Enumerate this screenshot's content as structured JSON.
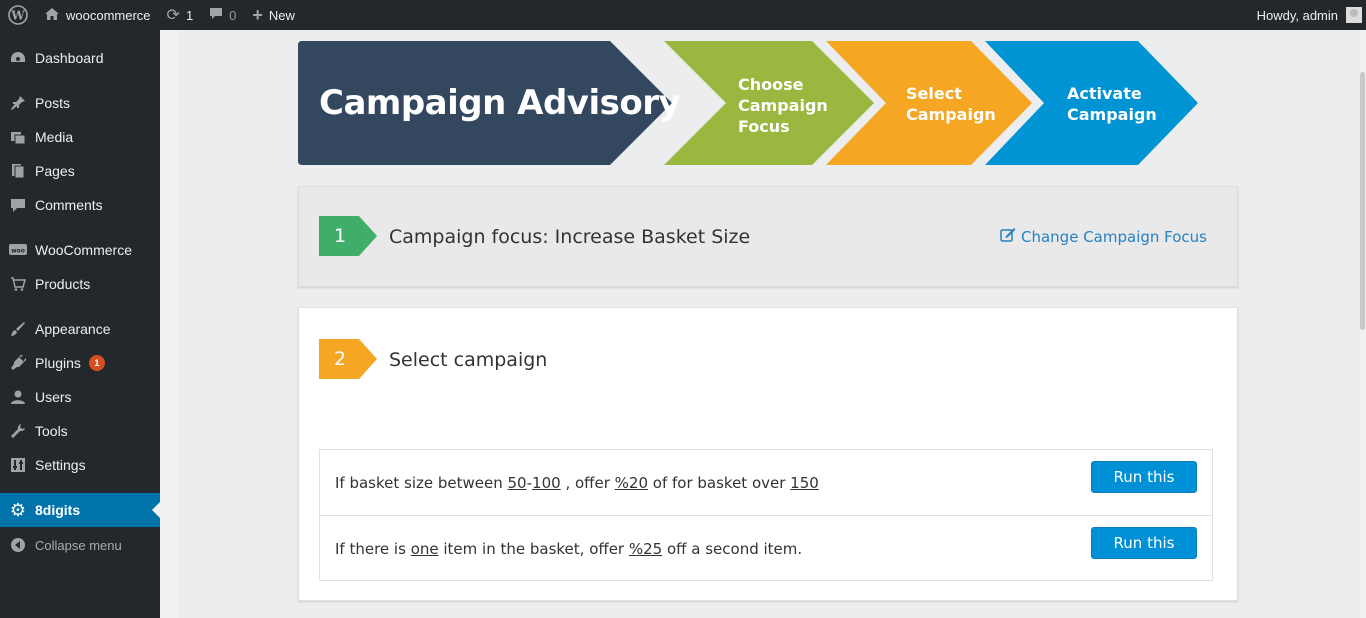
{
  "adminbar": {
    "site_name": "woocommerce",
    "updates_count": "1",
    "comments_count": "0",
    "new_label": "New",
    "howdy": "Howdy, admin"
  },
  "sidebar": {
    "items": [
      {
        "label": "Dashboard",
        "icon": "dashboard-icon"
      },
      {
        "label": "Posts",
        "icon": "pin-icon"
      },
      {
        "label": "Media",
        "icon": "media-icon"
      },
      {
        "label": "Pages",
        "icon": "pages-icon"
      },
      {
        "label": "Comments",
        "icon": "comment-icon"
      },
      {
        "label": "WooCommerce",
        "icon": "woo-icon"
      },
      {
        "label": "Products",
        "icon": "cart-icon"
      },
      {
        "label": "Appearance",
        "icon": "brush-icon"
      },
      {
        "label": "Plugins",
        "icon": "plugin-icon",
        "badge": "1"
      },
      {
        "label": "Users",
        "icon": "user-icon"
      },
      {
        "label": "Tools",
        "icon": "wrench-icon"
      },
      {
        "label": "Settings",
        "icon": "settings-icon"
      },
      {
        "label": "8digits",
        "icon": "gear-icon",
        "active": true
      },
      {
        "label": "Collapse menu",
        "icon": "collapse-icon"
      }
    ]
  },
  "banner": {
    "title": "Campaign Advisory",
    "steps": [
      {
        "line1": "Choose",
        "line2": "Campaign",
        "line3": "Focus",
        "color": "#9ab83f"
      },
      {
        "line1": "Select",
        "line2": "Campaign",
        "color": "#f5a623"
      },
      {
        "line1": "Activate",
        "line2": "Campaign",
        "color": "#0094d4"
      }
    ],
    "title_color": "#33475e"
  },
  "step1": {
    "number": "1",
    "heading": "Campaign focus: Increase Basket Size",
    "change_link": "Change Campaign Focus",
    "tag_color": "#3fae6a"
  },
  "step2": {
    "number": "2",
    "heading": "Select campaign",
    "tag_color": "#f5a623"
  },
  "campaigns": [
    {
      "t1": "If basket size between ",
      "v1": "50",
      "sep": "-",
      "v2": "100",
      "t2": " , offer ",
      "v3": "%20",
      "t3": " of for basket over ",
      "v4": "150",
      "button": "Run this"
    },
    {
      "t1": "If there is ",
      "v1": "one",
      "t2": " item in the basket, offer ",
      "v2": "%25",
      "t3": " off a second item.",
      "button": "Run this"
    }
  ]
}
